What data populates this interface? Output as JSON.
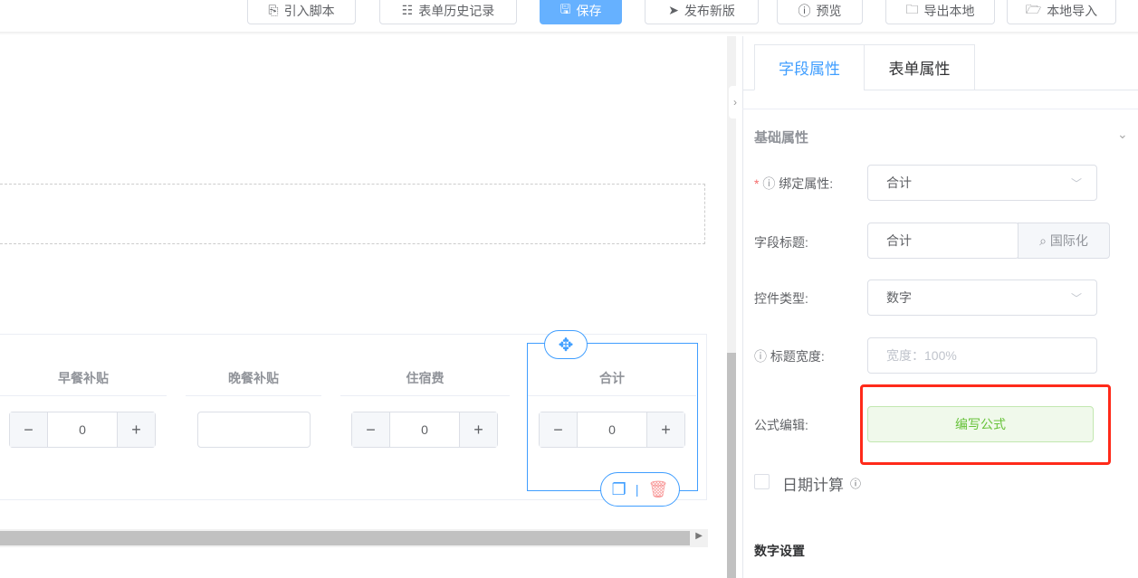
{
  "toolbar": {
    "import_script": "引入脚本",
    "history": "表单历史记录",
    "save": "保存",
    "publish": "发布新版",
    "preview": "预览",
    "export_local": "导出本地",
    "import_local": "本地导入"
  },
  "table": {
    "columns": [
      "早餐补贴",
      "晚餐补贴",
      "住宿费",
      "合计"
    ],
    "values": [
      "0",
      "",
      "0",
      "0"
    ]
  },
  "panel": {
    "tabs": [
      "字段属性",
      "表单属性"
    ],
    "section_basic": "基础属性",
    "bind_label": "绑定属性:",
    "bind_value": "合计",
    "title_label": "字段标题:",
    "title_value": "合计",
    "i18n": "国际化",
    "type_label": "控件类型:",
    "type_value": "数字",
    "width_label": "标题宽度:",
    "width_placeholder": "宽度：100%",
    "formula_label": "公式编辑:",
    "formula_button": "编写公式",
    "date_calc": "日期计算",
    "section_number": "数字设置"
  },
  "colors": {
    "primary": "#409eff",
    "highlight": "#ff2a1a",
    "formula_bg": "#f0f9eb"
  }
}
